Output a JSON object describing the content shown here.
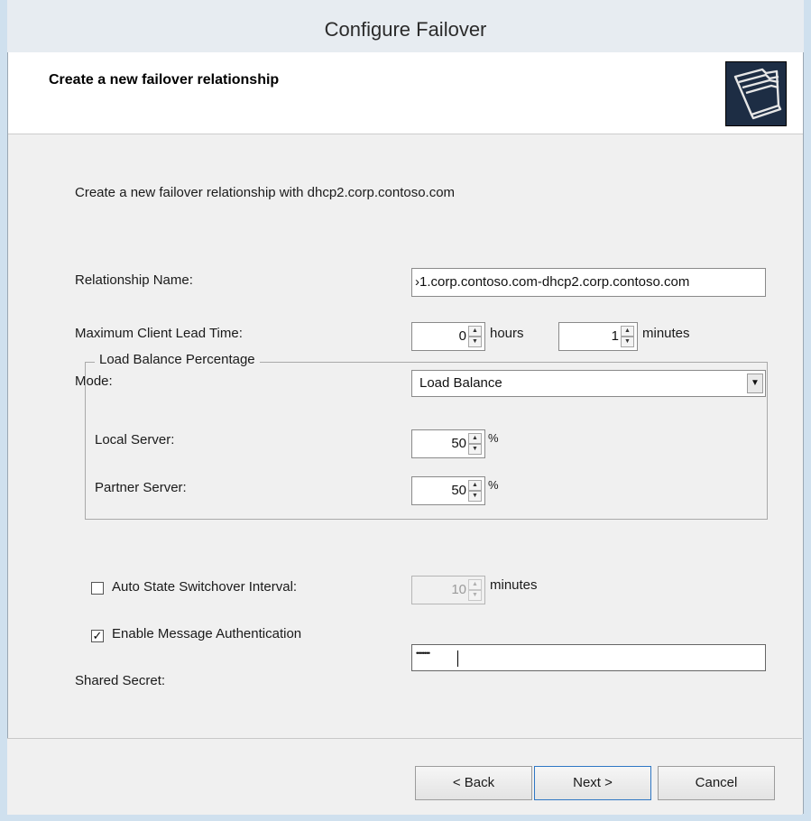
{
  "window": {
    "title": "Configure Failover"
  },
  "header": {
    "title": "Create a new failover relationship",
    "icon": "folders-icon"
  },
  "intro": "Create a new failover relationship with dhcp2.corp.contoso.com",
  "relationship_name": {
    "label": "Relationship Name:",
    "value": "›1.corp.contoso.com-dhcp2.corp.contoso.com"
  },
  "lead_time": {
    "label": "Maximum Client Lead Time:",
    "hours_value": "0",
    "hours_unit": "hours",
    "minutes_value": "1",
    "minutes_unit": "minutes"
  },
  "mode": {
    "label": "Mode:",
    "selected": "Load Balance"
  },
  "load_balance": {
    "legend": "Load Balance Percentage",
    "local_label": "Local Server:",
    "local_value": "50",
    "partner_label": "Partner Server:",
    "partner_value": "50",
    "unit": "%"
  },
  "auto_switchover": {
    "label": "Auto State Switchover Interval:",
    "checked": false,
    "value": "10",
    "unit": "minutes"
  },
  "message_auth": {
    "label": "Enable Message Authentication",
    "checked": true
  },
  "shared_secret": {
    "label": "Shared Secret:",
    "mask": "•••••••"
  },
  "buttons": {
    "back": "< Back",
    "next": "Next >",
    "cancel": "Cancel"
  },
  "colors": {
    "frame": "#cfe0ee",
    "panel": "#f0f0f0",
    "default_button_border": "#2f77c4"
  }
}
